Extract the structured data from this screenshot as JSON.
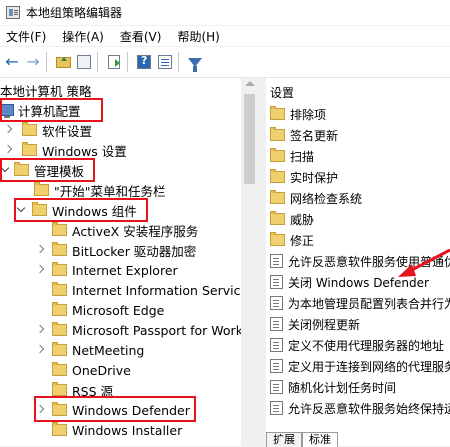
{
  "window": {
    "title": "本地组策略编辑器"
  },
  "menu": [
    "文件(F)",
    "操作(A)",
    "查看(V)",
    "帮助(H)"
  ],
  "toolbar": {
    "icons": [
      "back-arrow-icon",
      "forward-arrow-icon",
      "folder-up-icon",
      "show-hide-tree-icon",
      "export-list-icon",
      "help-icon",
      "properties-icon",
      "filter-icon"
    ]
  },
  "tree": {
    "root": "本地计算机 策略",
    "items": [
      {
        "label": "计算机配置",
        "level": 0,
        "state": "expanded"
      },
      {
        "label": "软件设置",
        "level": 1,
        "state": "collapsed"
      },
      {
        "label": "Windows 设置",
        "level": 1,
        "state": "collapsed"
      },
      {
        "label": "管理模板",
        "level": 1,
        "state": "expanded"
      },
      {
        "label": "\"开始\"菜单和任务栏",
        "level": 2,
        "state": "leaf"
      },
      {
        "label": "Windows 组件",
        "level": 2,
        "state": "expanded"
      },
      {
        "label": "ActiveX 安装程序服务",
        "level": 3,
        "state": "leaf"
      },
      {
        "label": "BitLocker 驱动器加密",
        "level": 3,
        "state": "collapsed"
      },
      {
        "label": "Internet Explorer",
        "level": 3,
        "state": "collapsed"
      },
      {
        "label": "Internet Information Services",
        "level": 3,
        "state": "leaf"
      },
      {
        "label": "Microsoft Edge",
        "level": 3,
        "state": "leaf"
      },
      {
        "label": "Microsoft Passport for Work",
        "level": 3,
        "state": "collapsed"
      },
      {
        "label": "NetMeeting",
        "level": 3,
        "state": "collapsed"
      },
      {
        "label": "OneDrive",
        "level": 3,
        "state": "leaf"
      },
      {
        "label": "RSS 源",
        "level": 3,
        "state": "leaf"
      },
      {
        "label": "Windows Defender",
        "level": 3,
        "state": "collapsed"
      },
      {
        "label": "Windows Installer",
        "level": 3,
        "state": "leaf"
      }
    ]
  },
  "rightpane": {
    "header": "设置",
    "folders": [
      "排除项",
      "签名更新",
      "扫描",
      "实时保护",
      "网络检查系统",
      "威胁",
      "修正"
    ],
    "settings": [
      "允许反恶意软件服务使用普通优先",
      "关闭 Windows Defender",
      "为本地管理员配置列表合并行为",
      "关闭例程更新",
      "定义不使用代理服务器的地址",
      "定义用于连接到网络的代理服务",
      "随机化计划任务时间",
      "允许反恶意软件服务始终保持运行"
    ]
  },
  "tabs": [
    "扩展",
    "标准"
  ],
  "colors": {
    "highlight_box": "#e4131d",
    "annotation_arrow": "#e4131d",
    "folder": "#f0cf6e"
  }
}
